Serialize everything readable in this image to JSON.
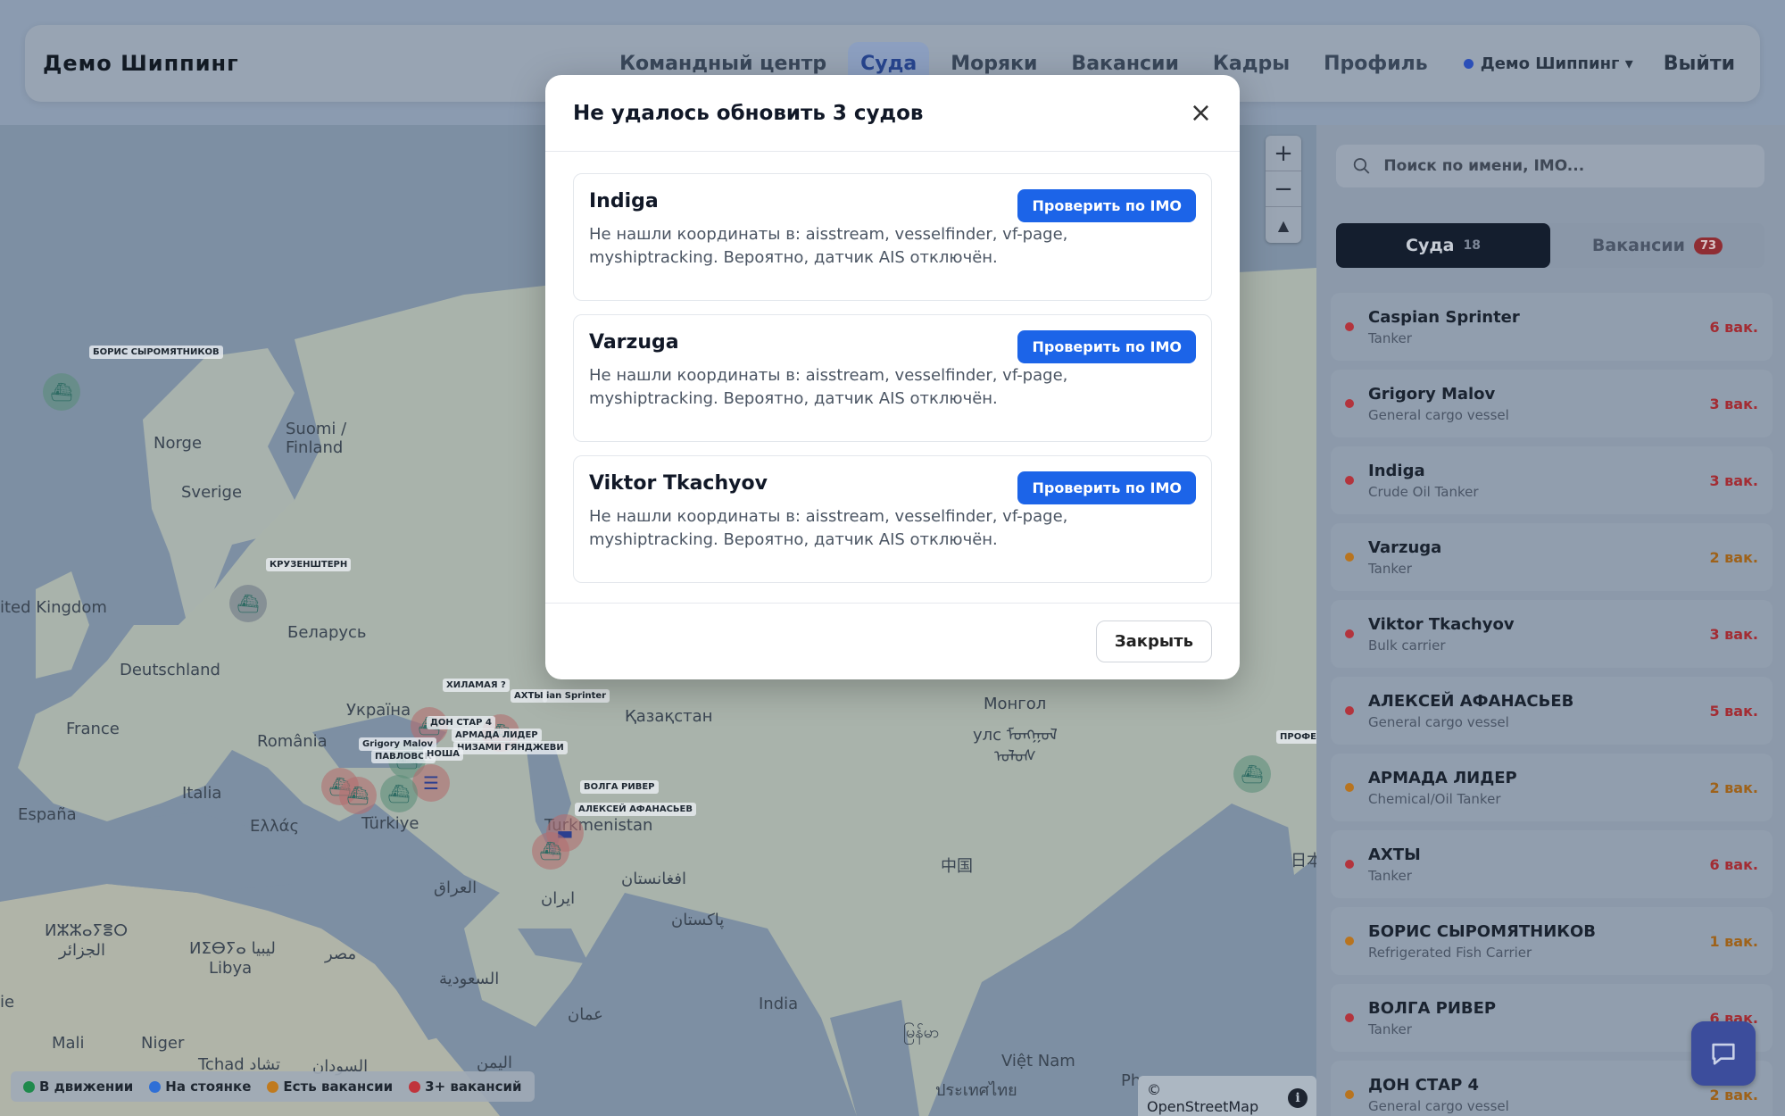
{
  "header": {
    "brand": "Демо Шиппинг",
    "nav": [
      "Командный центр",
      "Суда",
      "Моряки",
      "Вакансии",
      "Кадры",
      "Профиль"
    ],
    "active_nav": "Суда",
    "org": "Демо Шиппинг ▾",
    "logout": "Выйти"
  },
  "modal": {
    "title": "Не удалось обновить 3 судов",
    "check_label": "Проверить по IMO",
    "close_label": "Закрыть",
    "vessels": [
      {
        "name": "Indiga",
        "message": "Не нашли координаты в: aisstream, vesselfinder, vf-page, myshiptracking. Вероятно, датчик AIS отключён."
      },
      {
        "name": "Varzuga",
        "message": "Не нашли координаты в: aisstream, vesselfinder, vf-page, myshiptracking. Вероятно, датчик AIS отключён."
      },
      {
        "name": "Viktor Tkachyov",
        "message": "Не нашли координаты в: aisstream, vesselfinder, vf-page, myshiptracking. Вероятно, датчик AIS отключён."
      }
    ]
  },
  "sidebar": {
    "search_placeholder": "Поиск по имени, IMO...",
    "tabs": {
      "ships_label": "Суда",
      "ships_count": "18",
      "vacancies_label": "Вакансии",
      "vacancies_count": "73"
    },
    "vessels": [
      {
        "name": "Caspian Sprinter",
        "type": "Tanker",
        "vacancies": "6 вак.",
        "status": "red"
      },
      {
        "name": "Grigory Malov",
        "type": "General cargo vessel",
        "vacancies": "3 вак.",
        "status": "red"
      },
      {
        "name": "Indiga",
        "type": "Crude Oil Tanker",
        "vacancies": "3 вак.",
        "status": "red"
      },
      {
        "name": "Varzuga",
        "type": "Tanker",
        "vacancies": "2 вак.",
        "status": "orange"
      },
      {
        "name": "Viktor Tkachyov",
        "type": "Bulk carrier",
        "vacancies": "3 вак.",
        "status": "red"
      },
      {
        "name": "АЛЕКСЕЙ АФАНАСЬЕВ",
        "type": "General cargo vessel",
        "vacancies": "5 вак.",
        "status": "red"
      },
      {
        "name": "АРМАДА ЛИДЕР",
        "type": "Chemical/Oil Tanker",
        "vacancies": "2 вак.",
        "status": "orange"
      },
      {
        "name": "АХТЫ",
        "type": "Tanker",
        "vacancies": "6 вак.",
        "status": "red"
      },
      {
        "name": "БОРИС СЫРОМЯТНИКОВ",
        "type": "Refrigerated Fish Carrier",
        "vacancies": "1 вак.",
        "status": "orange"
      },
      {
        "name": "ВОЛГА РИВЕР",
        "type": "Tanker",
        "vacancies": "6 вак.",
        "status": "red"
      },
      {
        "name": "ДОН СТАР 4",
        "type": "General cargo vessel",
        "vacancies": "2 вак.",
        "status": "orange"
      }
    ]
  },
  "map": {
    "countries": [
      "Norge",
      "Suomi /",
      "Finland",
      "Sverige",
      "ited Kingdom",
      "Беларусь",
      "Deutschland",
      "France",
      "Україна",
      "România",
      "Italia",
      "España",
      "Ελλάς",
      "Türkiye",
      "Қазақстан",
      "Монгол",
      "улс ᠮᠣᠩᠭᠣᠯ",
      "ᠤᠯᠤᠰ",
      "Turkmenistan",
      "العراق",
      "ایران",
      "افغانستان",
      "پاکستان",
      "ⵍⵣⵣⴰⵢⴻⵔ",
      "الجزائر",
      "ⵍⵉⴱⵢⴰ ليبيا",
      "Libya",
      "مصر",
      "السعودية",
      "عمان",
      "India",
      "中国",
      "日本",
      "ie",
      "Mali",
      "Niger",
      "Tchad تشاد",
      "السودان",
      "اليمن",
      "မြန်မာ",
      "Việt Nam",
      "ประเทศไทย",
      "Ph"
    ],
    "ship_tags": [
      "БОРИС СЫРОМЯТНИКОВ",
      "КРУЗЕНШТЕРН",
      "ХИЛАМАЯ ?",
      "АХТЫ",
      "ian Sprinter",
      "ДОН СТАР 4",
      "АРМАДА ЛИДЕР",
      "Grigory Malov",
      "НИЗАМИ ГЯНДЖЕВИ",
      "ПАВЛОВСК",
      "НОША",
      "ВОЛГА РИВЕР",
      "АЛЕКСЕЙ АФАНАСЬЕВ",
      "ПРОФЕ"
    ],
    "legend": [
      "В движении",
      "На стоянке",
      "Есть вакансии",
      "3+ вакансий"
    ],
    "legend_colors": [
      "#1f8a4c",
      "#2f6fd6",
      "#c07a1e",
      "#c0343c"
    ],
    "attribution": "© OpenStreetMap",
    "info_glyph": "i"
  },
  "colors": {
    "status_red": "#b3343d",
    "status_orange": "#b8741f",
    "primary": "#1c64e8"
  }
}
